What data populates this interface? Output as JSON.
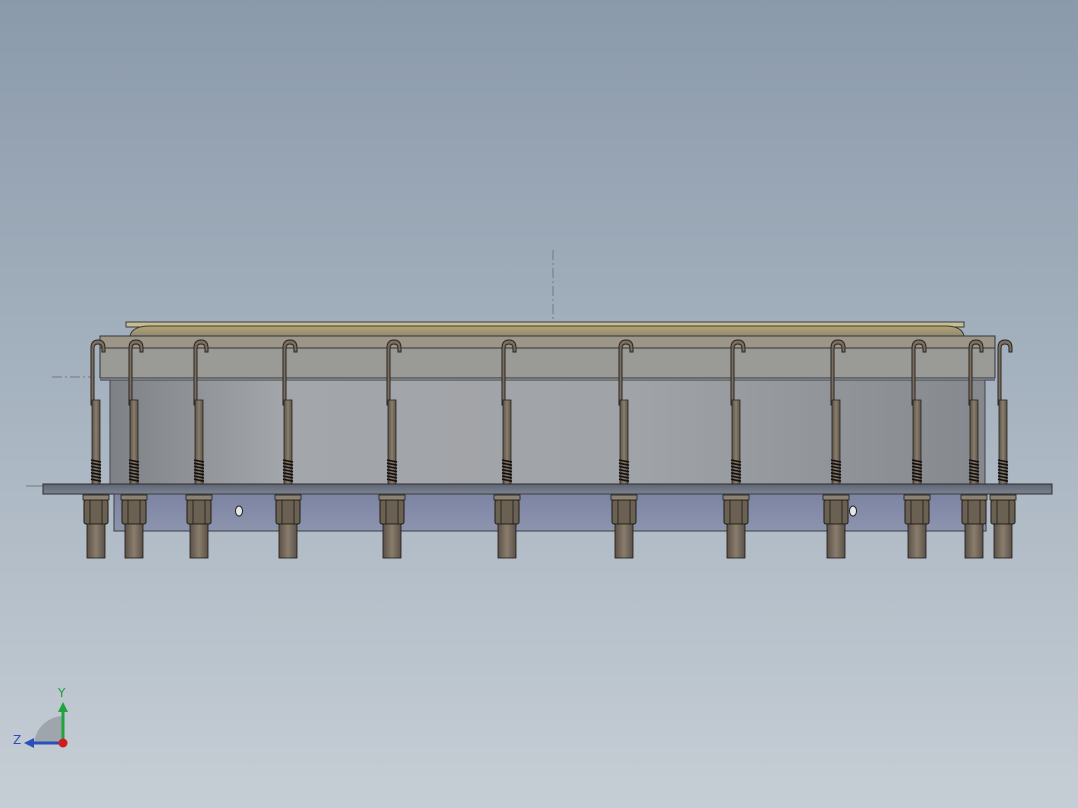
{
  "viewport": {
    "colors": {
      "bg_top": "#8b9aab",
      "bg_bottom": "#c6ced5",
      "tank_body": "#9b9ea3",
      "base_plate": "#6f7684",
      "bolt": "#6d6356",
      "nut": "#5a5247",
      "top_rim": "#a89a6e"
    },
    "bolts": [
      {
        "name": "bolt-1"
      },
      {
        "name": "bolt-2"
      },
      {
        "name": "bolt-3"
      },
      {
        "name": "bolt-4"
      },
      {
        "name": "bolt-5"
      },
      {
        "name": "bolt-6"
      },
      {
        "name": "bolt-7"
      },
      {
        "name": "bolt-8"
      },
      {
        "name": "bolt-9"
      },
      {
        "name": "bolt-10"
      },
      {
        "name": "bolt-11"
      },
      {
        "name": "bolt-12"
      }
    ]
  },
  "triad": {
    "y_label": "Y",
    "z_label": "Z",
    "colors": {
      "y": "#1fa33a",
      "z": "#2a4fb8",
      "x": "#d01c1c"
    }
  }
}
